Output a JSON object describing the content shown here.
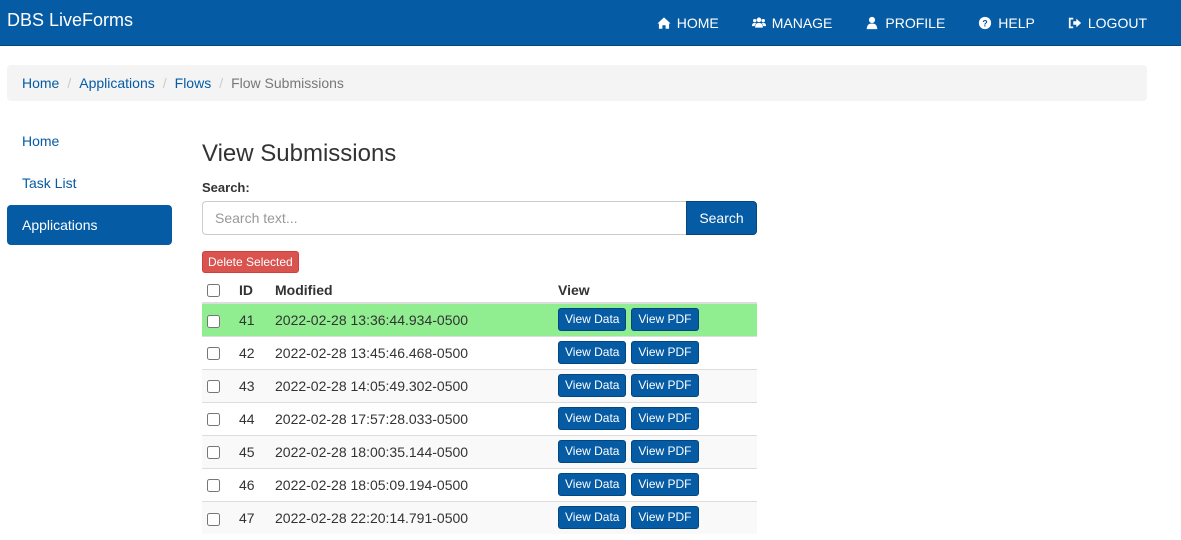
{
  "navbar": {
    "brand": "DBS LiveForms",
    "links": [
      {
        "label": "HOME",
        "icon": "home-icon"
      },
      {
        "label": "MANAGE",
        "icon": "users-icon"
      },
      {
        "label": "PROFILE",
        "icon": "user-icon"
      },
      {
        "label": "HELP",
        "icon": "question-circle-icon"
      },
      {
        "label": "LOGOUT",
        "icon": "logout-icon"
      }
    ]
  },
  "breadcrumb": {
    "items": [
      "Home",
      "Applications",
      "Flows"
    ],
    "active": "Flow Submissions",
    "separator": "/"
  },
  "sidebar": {
    "items": [
      {
        "label": "Home",
        "active": false
      },
      {
        "label": "Task List",
        "active": false
      },
      {
        "label": "Applications",
        "active": true
      }
    ]
  },
  "main": {
    "title": "View Submissions",
    "search_label": "Search:",
    "search_placeholder": "Search text...",
    "search_value": "",
    "search_button": "Search",
    "delete_button": "Delete Selected",
    "table": {
      "headers": {
        "id": "ID",
        "modified": "Modified",
        "view": "View"
      },
      "view_data_label": "View Data",
      "view_pdf_label": "View PDF",
      "highlight_color": "#90ee90",
      "rows": [
        {
          "id": "41",
          "modified": "2022-02-28 13:36:44.934-0500",
          "highlighted": true,
          "checked": false
        },
        {
          "id": "42",
          "modified": "2022-02-28 13:45:46.468-0500",
          "highlighted": false,
          "checked": false
        },
        {
          "id": "43",
          "modified": "2022-02-28 14:05:49.302-0500",
          "highlighted": false,
          "checked": false
        },
        {
          "id": "44",
          "modified": "2022-02-28 17:57:28.033-0500",
          "highlighted": false,
          "checked": false
        },
        {
          "id": "45",
          "modified": "2022-02-28 18:00:35.144-0500",
          "highlighted": false,
          "checked": false
        },
        {
          "id": "46",
          "modified": "2022-02-28 18:05:09.194-0500",
          "highlighted": false,
          "checked": false
        },
        {
          "id": "47",
          "modified": "2022-02-28 22:20:14.791-0500",
          "highlighted": false,
          "checked": false
        }
      ]
    }
  },
  "colors": {
    "primary": "#055ba4",
    "danger": "#d9534f",
    "highlight": "#90ee90",
    "breadcrumb_bg": "#f4f4f4"
  }
}
